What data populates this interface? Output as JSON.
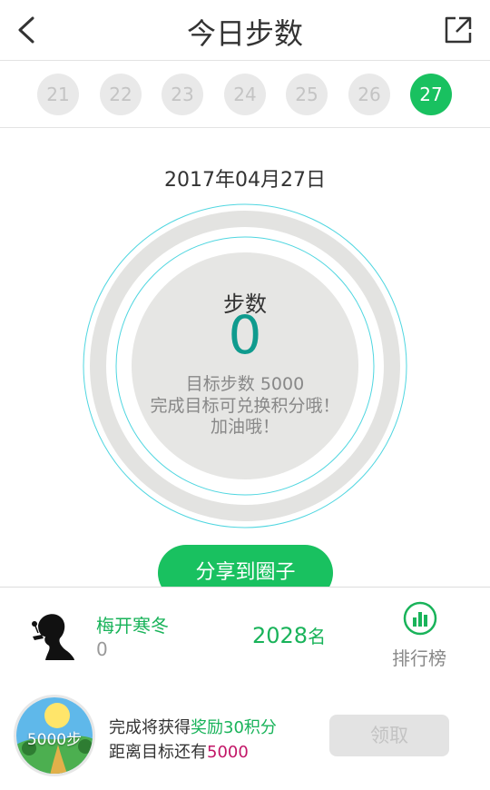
{
  "header": {
    "title": "今日步数"
  },
  "days": [
    "21",
    "22",
    "23",
    "24",
    "25",
    "26",
    "27"
  ],
  "date": "2017年04月27日",
  "ring": {
    "label": "步数",
    "value": "0",
    "goal": "目标步数 5000",
    "tip_line1": "完成目标可兑换积分哦！",
    "tip_line2": "加油哦！"
  },
  "share_button": "分享到圈子",
  "user": {
    "name": "梅开寒冬",
    "steps": "0",
    "rank_number": "2028",
    "rank_suffix": "名",
    "leaderboard_label": "排行榜"
  },
  "reward": {
    "badge_text": "5000步",
    "line1_prefix": "完成将获得",
    "line1_highlight": "奖励30积分",
    "line2_prefix": "距离目标还有",
    "line2_highlight": "5000",
    "claim_button": "领取"
  },
  "colors": {
    "accent_green": "#19c160",
    "value_teal": "#0f9b8e",
    "highlight_pink": "#c21667"
  }
}
